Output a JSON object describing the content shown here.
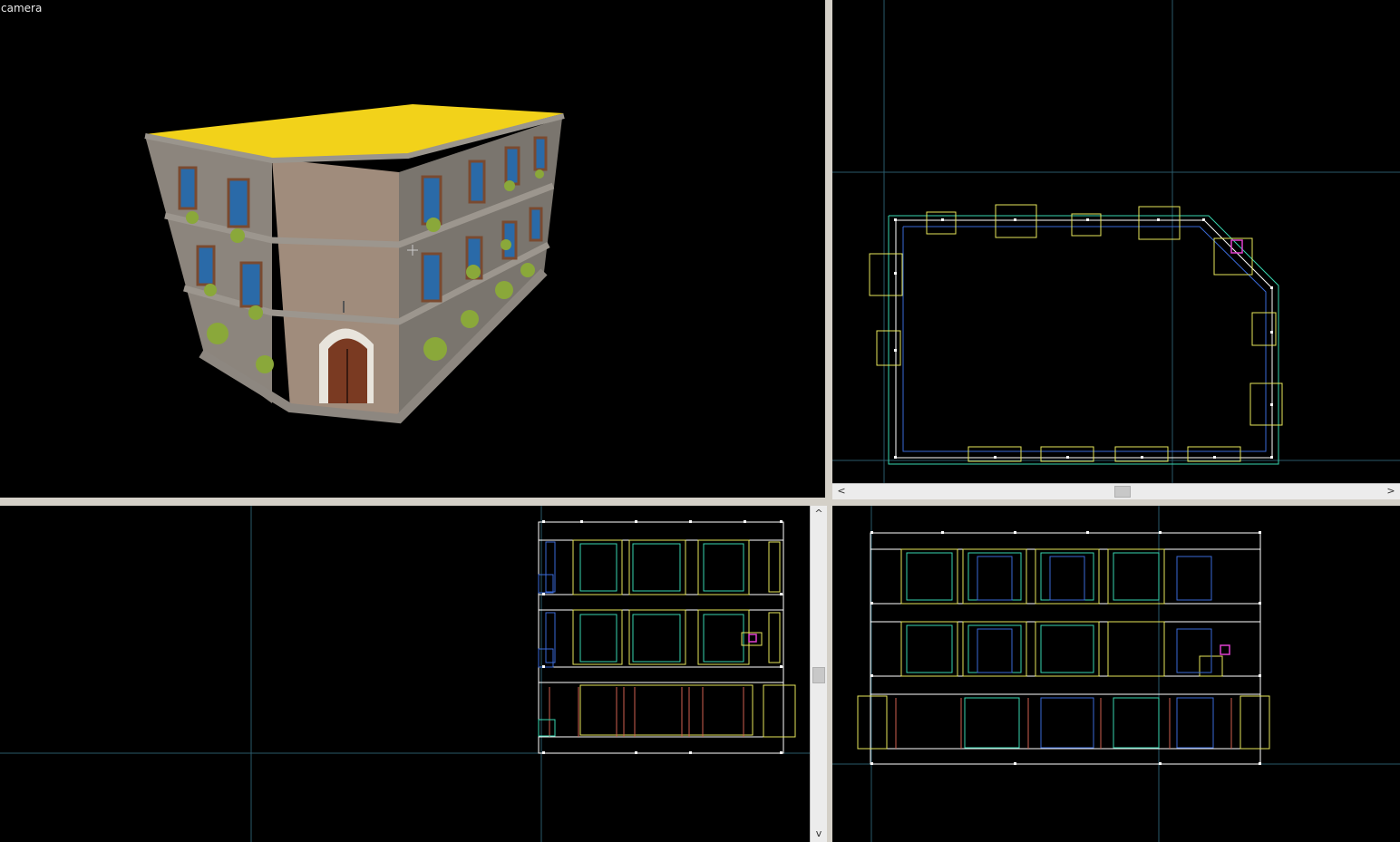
{
  "viewports": {
    "camera": {
      "label": "camera"
    }
  },
  "scrollbars": {
    "left_arrow": "<",
    "right_arrow": ">",
    "up_arrow": "^",
    "down_arrow": "v"
  },
  "colors": {
    "viewport_bg": "#000000",
    "roof": "#f2d21a",
    "grid_line": "#2a5a6a",
    "wire_white": "#ffffff",
    "wire_yellow": "#e6e65a",
    "wire_cyan": "#38d6b0",
    "wire_blue": "#3a6ad8",
    "wire_red": "#d06050",
    "wire_magenta": "#e040d0"
  }
}
